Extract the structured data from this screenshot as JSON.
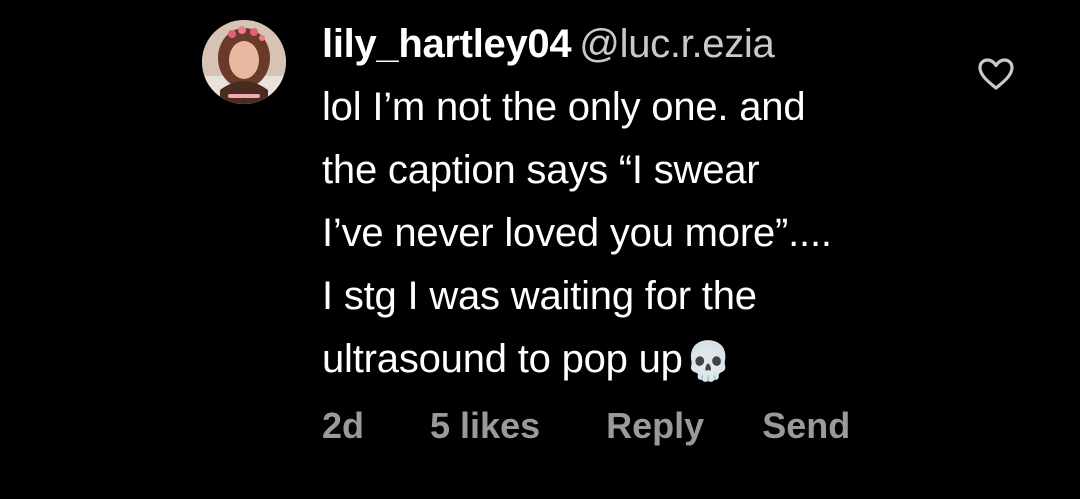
{
  "comment": {
    "username": "lily_hartley04",
    "handle": "@luc.r.ezia",
    "text_lines": [
      "lol I’m not the only one. and",
      "the caption says “I swear",
      "I’ve never loved you more”....",
      "I stg I was waiting for the",
      "ultrasound to pop up"
    ],
    "trailing_emoji": "💀",
    "time": "2d",
    "likes": "5 likes",
    "reply_label": "Reply",
    "send_label": "Send",
    "avatar_icon": "profile-photo",
    "like_icon": "heart-outline-icon"
  },
  "colors": {
    "background": "#000000",
    "text": "#ffffff",
    "handle": "#c9c9c9",
    "meta": "#9a9a9a"
  }
}
